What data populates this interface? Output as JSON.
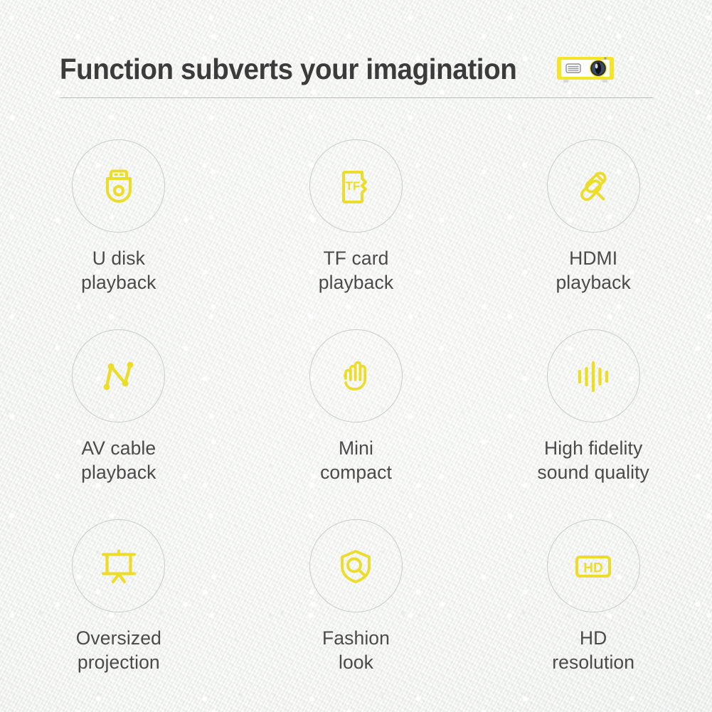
{
  "header": {
    "title": "Function subverts your imagination",
    "projector_icon_name": "mini-projector-icon",
    "divider_color": "#b9bcb8"
  },
  "theme": {
    "accent_yellow": "#eedf2c",
    "icon_stroke": "#ecdd2b",
    "circle_border": "#c9ccc8",
    "text_color": "#4a4a4a",
    "title_color": "#3b3b3b",
    "background": "#f6f7f5"
  },
  "features": [
    {
      "id": "u-disk-playback",
      "icon": "usb-drive-icon",
      "label": "U disk\nplayback"
    },
    {
      "id": "tf-card-playback",
      "icon": "tf-card-icon",
      "label": "TF card\nplayback"
    },
    {
      "id": "hdmi-playback",
      "icon": "hdmi-cable-icon",
      "label": "HDMI\nplayback"
    },
    {
      "id": "av-cable-playback",
      "icon": "av-cable-icon",
      "label": "AV cable\nplayback"
    },
    {
      "id": "mini-compact",
      "icon": "open-hand-icon",
      "label": "Mini\ncompact"
    },
    {
      "id": "sound-quality",
      "icon": "sound-wave-icon",
      "label": "High fidelity\nsound quality"
    },
    {
      "id": "oversized-projection",
      "icon": "projector-screen-icon",
      "label": "Oversized\nprojection"
    },
    {
      "id": "fashion-look",
      "icon": "shield-search-icon",
      "label": "Fashion\nlook"
    },
    {
      "id": "hd-resolution",
      "icon": "hd-badge-icon",
      "label": "HD\nresolution"
    }
  ],
  "icon_text": {
    "tf_card": "TF",
    "hd_badge": "HD"
  }
}
